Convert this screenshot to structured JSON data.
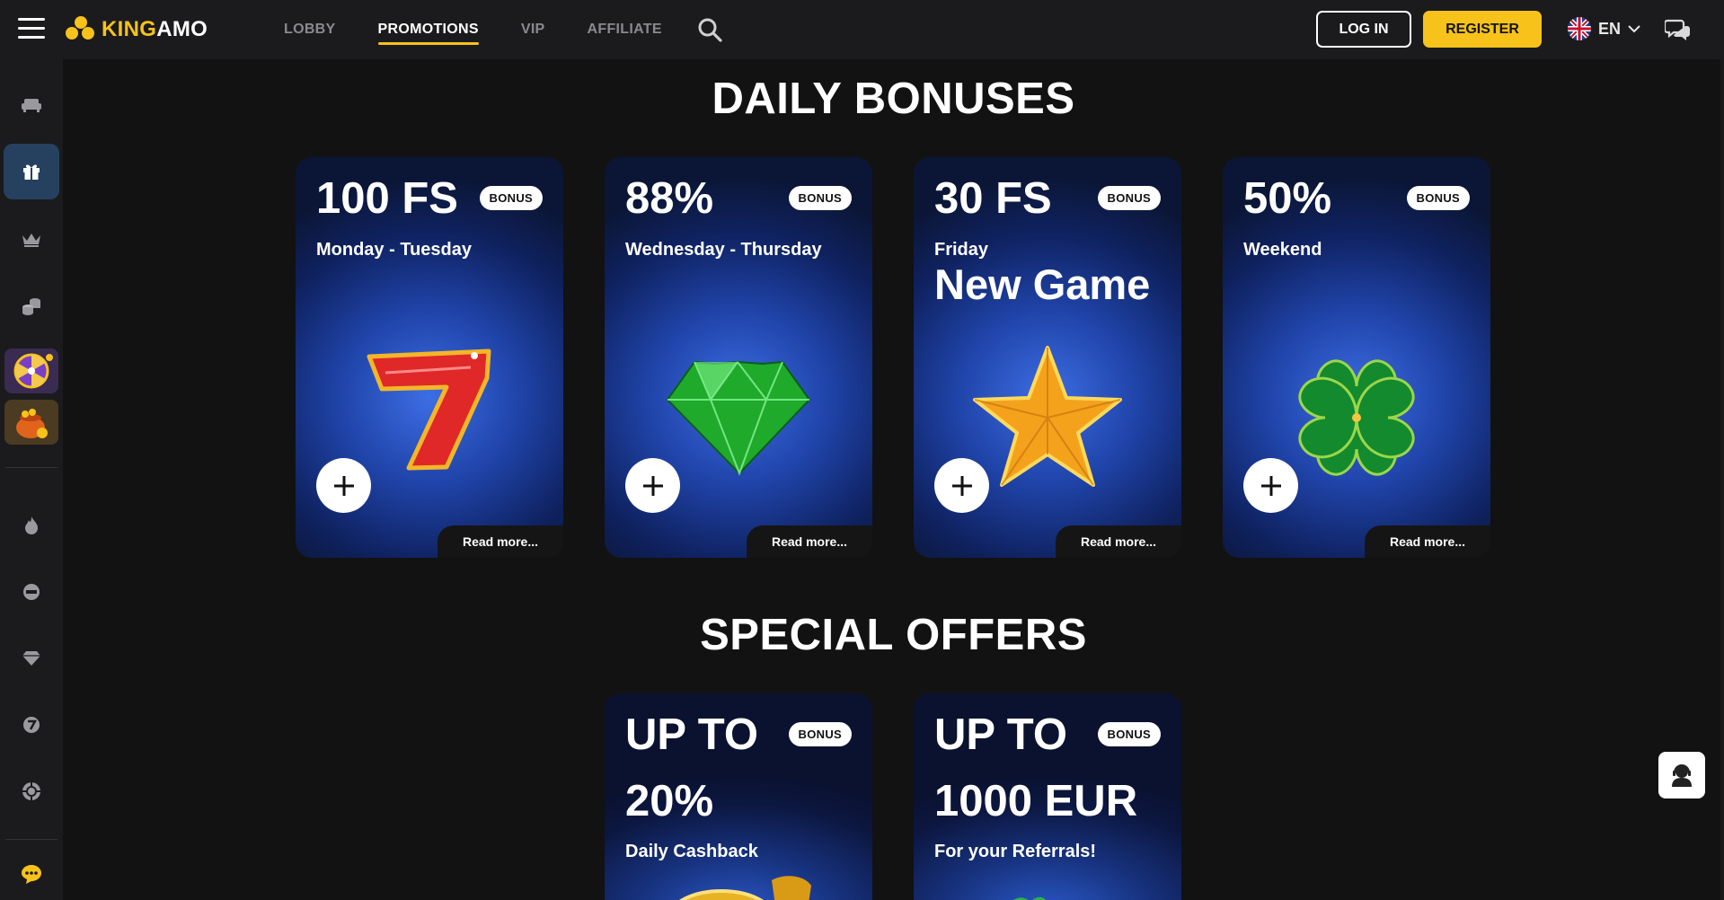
{
  "header": {
    "logo": {
      "brand_k": "KING",
      "brand_rest": "AMO"
    },
    "nav": [
      {
        "label": "LOBBY",
        "active": false
      },
      {
        "label": "PROMOTIONS",
        "active": true
      },
      {
        "label": "VIP",
        "active": false
      },
      {
        "label": "AFFILIATE",
        "active": false
      }
    ],
    "login_label": "LOG IN",
    "register_label": "REGISTER",
    "language": "EN"
  },
  "sidebar": {
    "items": [
      {
        "name": "lobby-sofa-icon"
      },
      {
        "name": "gift-icon",
        "active": true
      },
      {
        "name": "crown-icon"
      },
      {
        "name": "coins-icon"
      },
      {
        "name": "wheel-of-fortune-icon"
      },
      {
        "name": "treasure-pot-icon"
      },
      {
        "name": "fire-icon"
      },
      {
        "name": "new-icon"
      },
      {
        "name": "diamond-icon"
      },
      {
        "name": "number-seven-icon"
      },
      {
        "name": "poker-chip-icon"
      },
      {
        "name": "chat-bubble-icon"
      }
    ]
  },
  "daily": {
    "title": "DAILY BONUSES",
    "cards": [
      {
        "value": "100 FS",
        "badge": "BONUS",
        "days": "Monday - Tuesday",
        "extra": "",
        "read_more": "Read more...",
        "art": "red-seven-icon"
      },
      {
        "value": "88%",
        "badge": "BONUS",
        "days": "Wednesday - Thursday",
        "extra": "",
        "read_more": "Read more...",
        "art": "green-diamond-icon"
      },
      {
        "value": "30 FS",
        "badge": "BONUS",
        "days": "Friday",
        "extra": "New Game",
        "read_more": "Read more...",
        "art": "gold-star-icon"
      },
      {
        "value": "50%",
        "badge": "BONUS",
        "days": "Weekend",
        "extra": "",
        "read_more": "Read more...",
        "art": "four-leaf-clover-icon"
      }
    ]
  },
  "special": {
    "title": "SPECIAL OFFERS",
    "cards": [
      {
        "line1": "UP TO",
        "badge": "BONUS",
        "line2": "20%",
        "sub": "Daily Cashback"
      },
      {
        "line1": "UP TO",
        "badge": "BONUS",
        "line2": "1000 EUR",
        "sub": "For your Referrals!"
      }
    ]
  },
  "colors": {
    "accent": "#f7c21a",
    "bg": "#121212",
    "panel": "#1b1b1d",
    "card_blue": "#1f43a8"
  }
}
